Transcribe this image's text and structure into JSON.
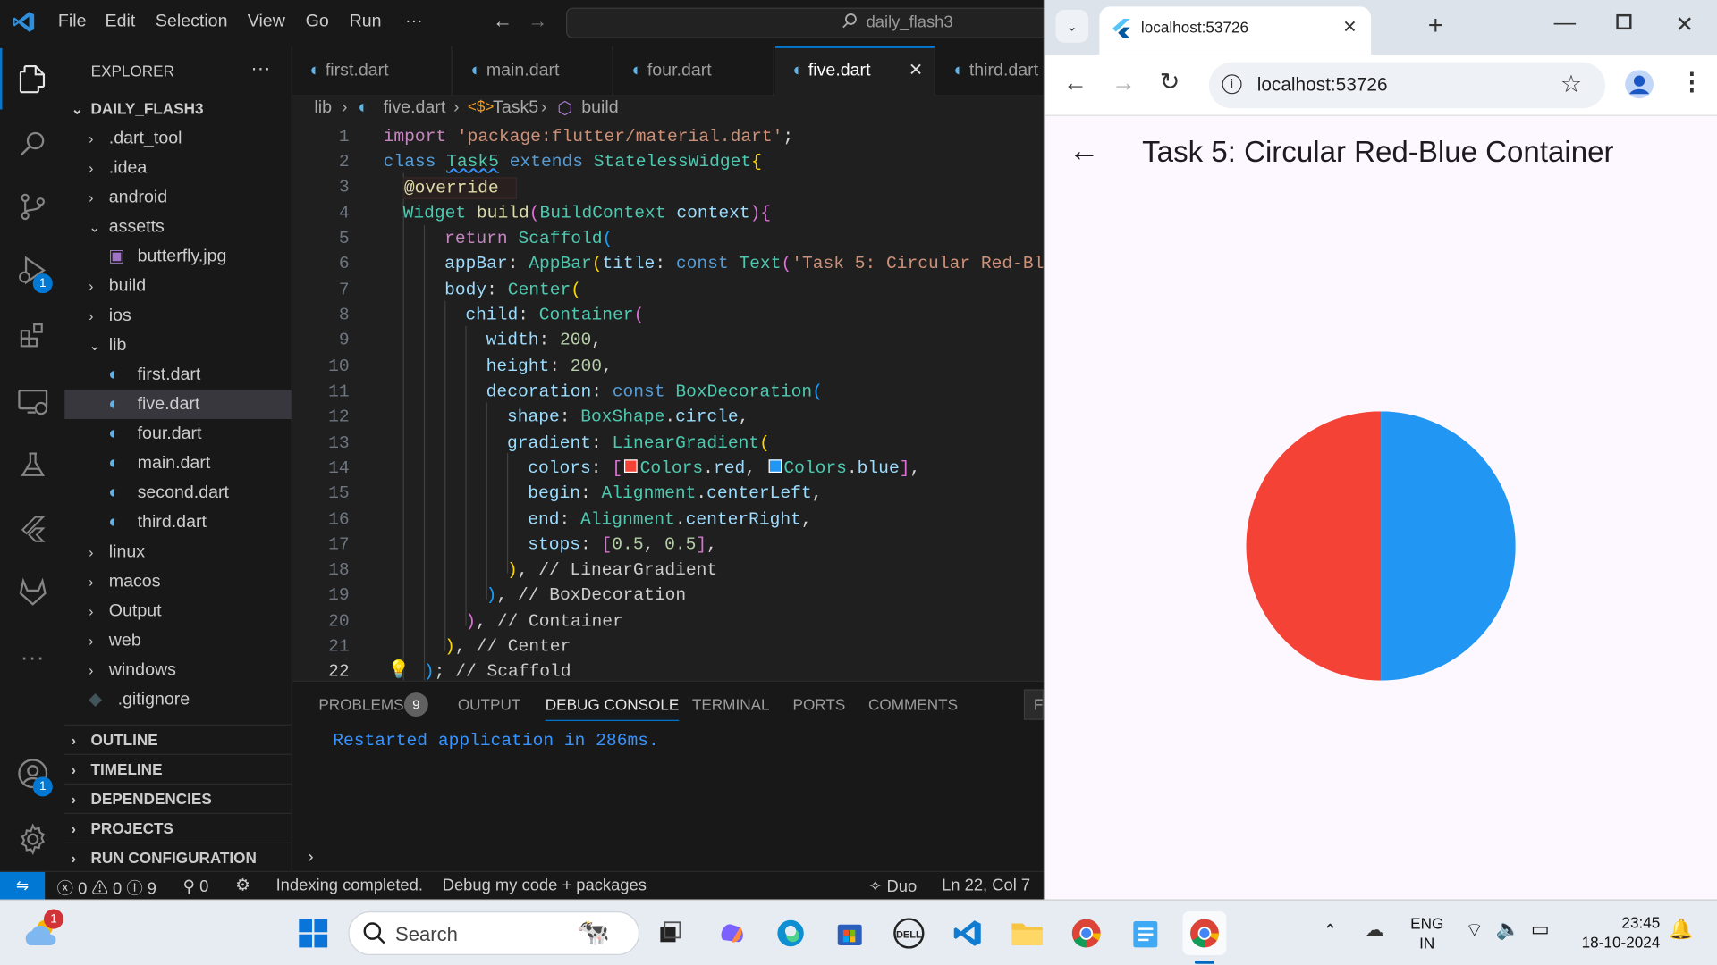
{
  "vscode": {
    "menu": [
      "File",
      "Edit",
      "Selection",
      "View",
      "Go",
      "Run",
      "···"
    ],
    "command_center": "daily_flash3",
    "activity_badges": {
      "debug": "1",
      "accounts": "1"
    },
    "explorer": {
      "title": "EXPLORER",
      "more": "···",
      "root": "DAILY_FLASH3",
      "items": [
        {
          "label": ".dart_tool",
          "type": "folder",
          "open": false
        },
        {
          "label": ".idea",
          "type": "folder",
          "open": false
        },
        {
          "label": "android",
          "type": "folder",
          "open": false
        },
        {
          "label": "assetts",
          "type": "folder",
          "open": true
        },
        {
          "label": "butterfly.jpg",
          "type": "image"
        },
        {
          "label": "build",
          "type": "folder",
          "open": false
        },
        {
          "label": "ios",
          "type": "folder",
          "open": false
        },
        {
          "label": "lib",
          "type": "folder",
          "open": true
        },
        {
          "label": "first.dart",
          "type": "dart"
        },
        {
          "label": "five.dart",
          "type": "dart",
          "selected": true
        },
        {
          "label": "four.dart",
          "type": "dart"
        },
        {
          "label": "main.dart",
          "type": "dart"
        },
        {
          "label": "second.dart",
          "type": "dart"
        },
        {
          "label": "third.dart",
          "type": "dart"
        },
        {
          "label": "linux",
          "type": "folder",
          "open": false
        },
        {
          "label": "macos",
          "type": "folder",
          "open": false
        },
        {
          "label": "Output",
          "type": "folder",
          "open": false
        },
        {
          "label": "web",
          "type": "folder",
          "open": false
        },
        {
          "label": "windows",
          "type": "folder",
          "open": false
        },
        {
          "label": ".gitignore",
          "type": "git"
        }
      ],
      "sections": [
        "OUTLINE",
        "TIMELINE",
        "DEPENDENCIES",
        "PROJECTS",
        "RUN CONFIGURATION"
      ]
    },
    "tabs": [
      {
        "label": "first.dart",
        "active": false
      },
      {
        "label": "main.dart",
        "active": false
      },
      {
        "label": "four.dart",
        "active": false
      },
      {
        "label": "five.dart",
        "active": true
      },
      {
        "label": "third.dart",
        "active": false
      }
    ],
    "breadcrumb": [
      "lib",
      "five.dart",
      "Task5",
      "build"
    ],
    "line_numbers": [
      "1",
      "2",
      "3",
      "4",
      "5",
      "6",
      "7",
      "8",
      "9",
      "10",
      "11",
      "12",
      "13",
      "14",
      "15",
      "16",
      "17",
      "18",
      "19",
      "20",
      "21",
      "22"
    ],
    "code": {
      "l1": [
        "import",
        "'package:flutter/material.dart'",
        ";"
      ],
      "l2": [
        "class",
        "Task5",
        "extends",
        "StatelessWidget",
        "{"
      ],
      "l3": [
        "@override"
      ],
      "l4": [
        "Widget",
        "build",
        "(",
        "BuildContext",
        "context",
        ")",
        "{"
      ],
      "l5": [
        "return",
        "Scaffold",
        "("
      ],
      "l6": [
        "appBar",
        ":",
        "AppBar",
        "(",
        "title",
        ":",
        "const",
        "Text",
        "(",
        "'Task 5: Circular Red-Blu"
      ],
      "l7": [
        "body",
        ":",
        "Center",
        "("
      ],
      "l8": [
        "child",
        ":",
        "Container",
        "("
      ],
      "l9": [
        "width",
        ":",
        "200",
        ","
      ],
      "l10": [
        "height",
        ":",
        "200",
        ","
      ],
      "l11": [
        "decoration",
        ":",
        "const",
        "BoxDecoration",
        "("
      ],
      "l12": [
        "shape",
        ":",
        "BoxShape",
        ".",
        "circle",
        ","
      ],
      "l13": [
        "gradient",
        ":",
        "LinearGradient",
        "("
      ],
      "l14": [
        "colors",
        ":",
        "[",
        "Colors",
        ".",
        "red",
        ",",
        "Colors",
        ".",
        "blue",
        "]",
        ","
      ],
      "l15": [
        "begin",
        ":",
        "Alignment",
        ".",
        "centerLeft",
        ","
      ],
      "l16": [
        "end",
        ":",
        "Alignment",
        ".",
        "centerRight",
        ","
      ],
      "l17": [
        "stops",
        ":",
        "[",
        "0.5",
        ",",
        "0.5",
        "]",
        ","
      ],
      "l18": [
        ")",
        ",",
        "// LinearGradient"
      ],
      "l19": [
        ")",
        ",",
        "// BoxDecoration"
      ],
      "l20": [
        ")",
        ",",
        "// Container"
      ],
      "l21": [
        ")",
        ",",
        "// Center"
      ],
      "l22": [
        ")",
        ";",
        "// Scaffold"
      ]
    },
    "panel": {
      "tabs": [
        "PROBLEMS",
        "OUTPUT",
        "DEBUG CONSOLE",
        "TERMINAL",
        "PORTS",
        "COMMENTS"
      ],
      "problems_count": "9",
      "active_tab": "DEBUG CONSOLE",
      "console_line": "Restarted application in 286ms.",
      "overflow_tab": "F"
    },
    "status": {
      "errors": "0",
      "warnings": "0",
      "infos": "9",
      "ports": "0",
      "indexing": "Indexing completed.",
      "debug_mode": "Debug my code + packages",
      "duo": "Duo",
      "position": "Ln 22, Col 7"
    }
  },
  "browser": {
    "tab_title": "localhost:53726",
    "url": "localhost:53726",
    "app_title": "Task 5: Circular Red-Blue Container",
    "circle_colors": {
      "left": "#f44336",
      "right": "#2196f3"
    }
  },
  "taskbar": {
    "search": "Search",
    "weather_badge": "1",
    "lang_top": "ENG",
    "lang_bottom": "IN",
    "time": "23:45",
    "date": "18-10-2024"
  },
  "colors": {
    "accent": "#0078d4",
    "flutter_blue": "#2196f3",
    "flutter_red": "#f44336"
  }
}
